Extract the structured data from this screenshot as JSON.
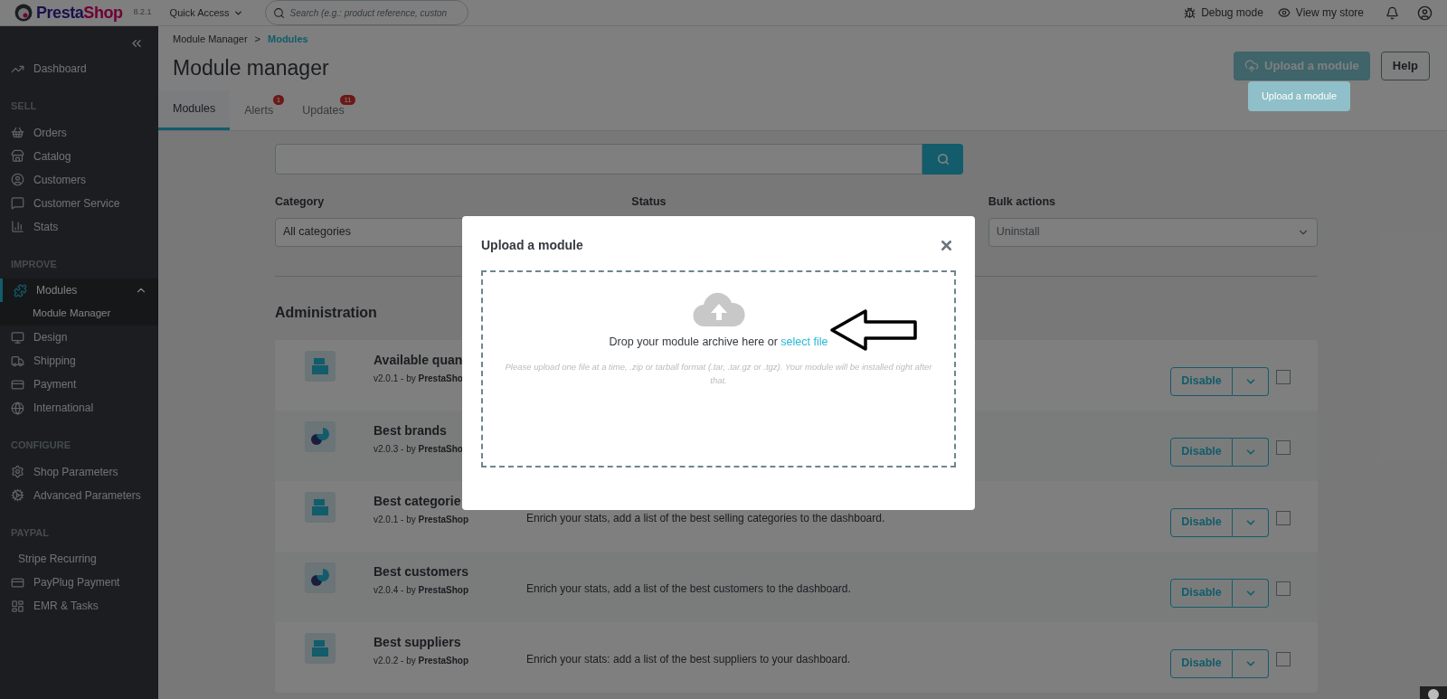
{
  "header": {
    "logo": {
      "part1": "Presta",
      "part2": "Shop"
    },
    "version": "8.2.1",
    "quick_access": "Quick Access",
    "search": {
      "placeholder": "Search (e.g.: product reference, custon"
    },
    "debug_mode": "Debug mode",
    "view_store": "View my store"
  },
  "sidebar": {
    "items": [
      {
        "kind": "item",
        "label": "Dashboard",
        "selected": false
      },
      {
        "kind": "heading",
        "label": "SELL"
      },
      {
        "kind": "item",
        "label": "Orders",
        "selected": false
      },
      {
        "kind": "item",
        "label": "Catalog",
        "selected": false
      },
      {
        "kind": "item",
        "label": "Customers",
        "selected": false
      },
      {
        "kind": "item",
        "label": "Customer Service",
        "selected": false
      },
      {
        "kind": "item",
        "label": "Stats",
        "selected": false
      },
      {
        "kind": "heading",
        "label": "IMPROVE"
      },
      {
        "kind": "item",
        "label": "Modules",
        "selected": true,
        "expanded": true,
        "children": [
          {
            "label": "Module Manager",
            "selected": true
          }
        ]
      },
      {
        "kind": "item",
        "label": "Design",
        "selected": false
      },
      {
        "kind": "item",
        "label": "Shipping",
        "selected": false
      },
      {
        "kind": "item",
        "label": "Payment",
        "selected": false
      },
      {
        "kind": "item",
        "label": "International",
        "selected": false
      },
      {
        "kind": "heading",
        "label": "CONFIGURE"
      },
      {
        "kind": "item",
        "label": "Shop Parameters",
        "selected": false
      },
      {
        "kind": "item",
        "label": "Advanced Parameters",
        "selected": false
      },
      {
        "kind": "heading",
        "label": "PAYPAL"
      },
      {
        "kind": "plain",
        "label": "Stripe Recurring",
        "selected": false
      },
      {
        "kind": "item",
        "label": "PayPlug Payment",
        "selected": false
      },
      {
        "kind": "item",
        "label": "EMR & Tasks",
        "selected": false
      }
    ]
  },
  "breadcrumb": [
    "Module Manager",
    ">",
    "Modules"
  ],
  "page_title": "Module manager",
  "actions": {
    "upload": "Upload a module",
    "help": "Help",
    "tooltip": "Upload a module"
  },
  "tabs": [
    {
      "label": "Modules",
      "selected": true
    },
    {
      "label": "Alerts",
      "selected": false,
      "badge": "1"
    },
    {
      "label": "Updates",
      "selected": false,
      "badge": "11"
    }
  ],
  "filters": {
    "category_label": "Category",
    "category_value": "All categories",
    "status_label": "Status",
    "bulk_label": "Bulk actions",
    "bulk_value": "Uninstall"
  },
  "section_title": "Administration",
  "modules": [
    {
      "name": "Available quan",
      "version": "v2.0.1 - by **PrestaSho**",
      "button": "Disable",
      "checked": false
    },
    {
      "name": "Best brands",
      "version": "v2.0.3 - by **PrestaSho**",
      "button": "Disable",
      "checked": false
    },
    {
      "name": "Best categorie",
      "version": "v2.0.1 - by **PrestaShop**",
      "description": "Enrich your stats, add a list of the best selling categories to the dashboard.",
      "button": "Disable",
      "checked": false
    },
    {
      "name": "Best customers",
      "version": "v2.0.4 - by **PrestaShop**",
      "description": "Enrich your stats, add a list of the best customers to the dashboard.",
      "button": "Disable",
      "checked": false
    },
    {
      "name": "Best suppliers",
      "version": "v2.0.2 - by **PrestaShop**",
      "description": "Enrich your stats: add a list of the best suppliers to your dashboard.",
      "button": "Disable",
      "checked": false
    }
  ],
  "modal": {
    "title": "Upload a module",
    "drop_text": "Drop your module archive here or ",
    "link": "select file",
    "hint": "Please upload one file at a time, .zip or tarball format (.tar, .tar.gz or .tgz). Your module will be installed right after that."
  }
}
